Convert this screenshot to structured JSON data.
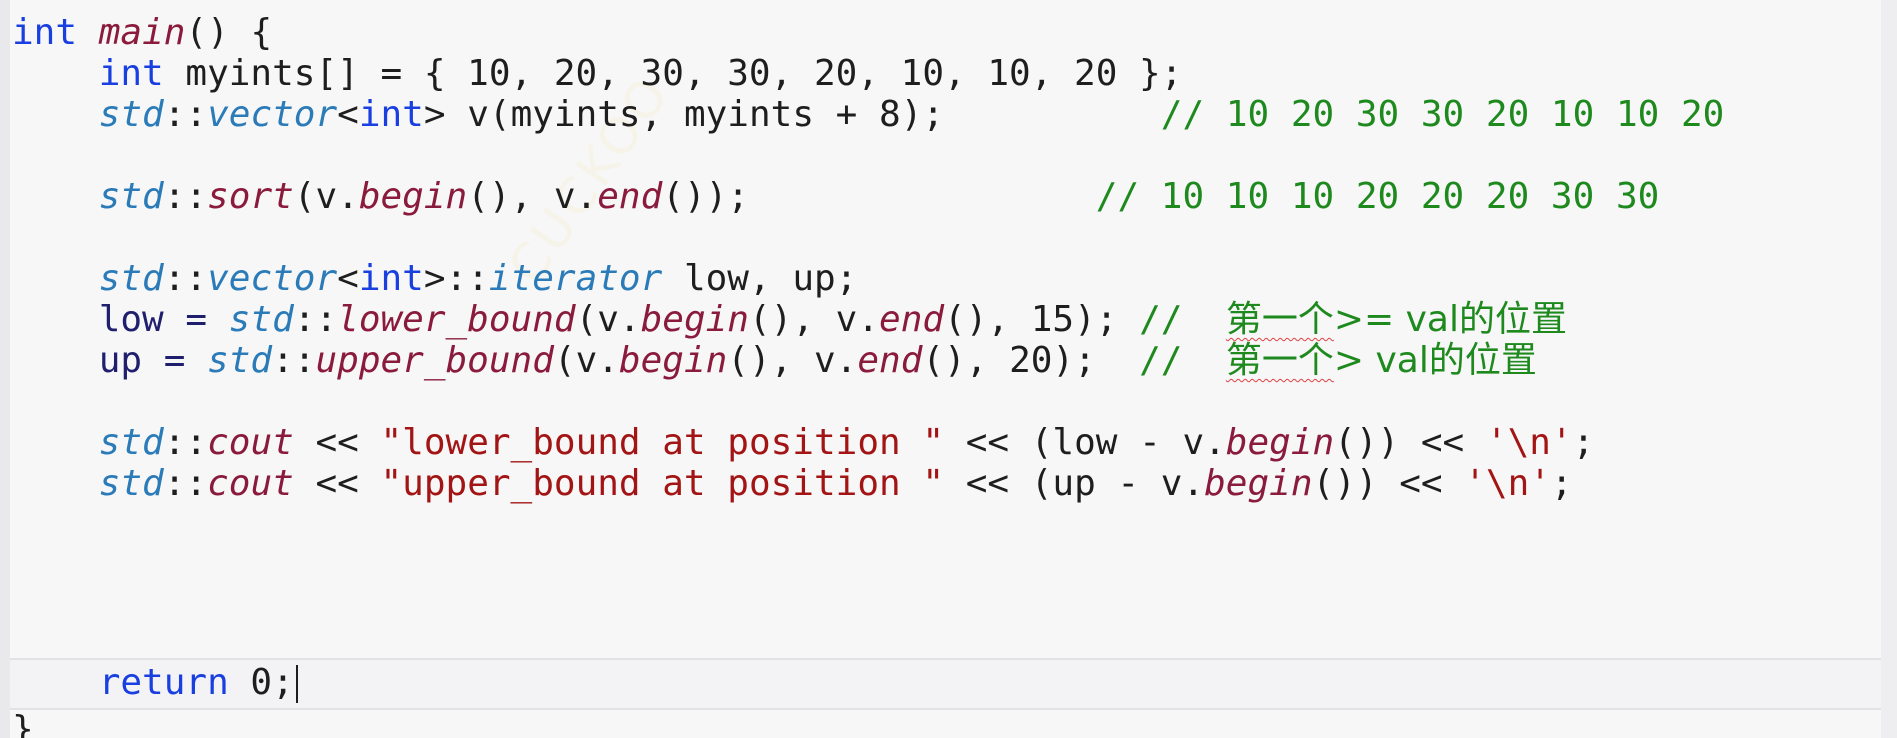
{
  "code": {
    "l1": {
      "kw_int": "int",
      "fn_main": "main",
      "rest": "() {"
    },
    "l2": {
      "indent": "    ",
      "kw_int": "int",
      "rest": " myints[] = { 10, 20, 30, 30, 20, 10, 10, 20 };"
    },
    "l3": {
      "indent": "    ",
      "ns": "std",
      "sep1": "::",
      "ty": "vector",
      "lt": "<",
      "kw_int": "int",
      "gt": "> ",
      "rest": "v(myints, myints + 8);",
      "pad": "          ",
      "comment": "// 10 20 30 30 20 10 10 20"
    },
    "l5": {
      "indent": "    ",
      "ns": "std",
      "sep1": "::",
      "fn": "sort",
      "p1": "(v.",
      "m1": "begin",
      "p2": "(), v.",
      "m2": "end",
      "p3": "());",
      "pad": "                ",
      "comment": "// 10 10 10 20 20 20 30 30"
    },
    "l7": {
      "indent": "    ",
      "ns": "std",
      "sep1": "::",
      "ty": "vector",
      "lt": "<",
      "kw_int": "int",
      "gt": ">::",
      "ty2": "iterator",
      "rest": " low, up;"
    },
    "l8": {
      "indent": "    ",
      "pre": "low = ",
      "ns": "std",
      "sep1": "::",
      "fn": "lower_bound",
      "p1": "(v.",
      "m1": "begin",
      "p2": "(), v.",
      "m2": "end",
      "p3": "(), 15); ",
      "cm_slash": "//  ",
      "cm_cn": "第一个",
      "cm_rest": ">= val的位置"
    },
    "l9": {
      "indent": "    ",
      "pre": "up = ",
      "ns": "std",
      "sep1": "::",
      "fn": "upper_bound",
      "p1": "(v.",
      "m1": "begin",
      "p2": "(), v.",
      "m2": "end",
      "p3": "(), 20);  ",
      "cm_slash": "//  ",
      "cm_cn": "第一个",
      "cm_rest": "> val的位置"
    },
    "l11": {
      "indent": "    ",
      "ns": "std",
      "sep1": "::",
      "obj": "cout",
      "op1": " << ",
      "str": "\"lower_bound at position \"",
      "op2": " << (low - v.",
      "m1": "begin",
      "p1": "()) << ",
      "chr": "'\\n'",
      "end": ";"
    },
    "l12": {
      "indent": "    ",
      "ns": "std",
      "sep1": "::",
      "obj": "cout",
      "op1": " << ",
      "str": "\"upper_bound at position \"",
      "op2": " << (up - v.",
      "m1": "begin",
      "p1": "()) << ",
      "chr": "'\\n'",
      "end": ";"
    },
    "l14": {
      "indent": "    ",
      "kw_return": "return",
      "rest": " 0;"
    },
    "l15": {
      "brace": "}"
    }
  },
  "watermark": "CUCKOO",
  "colors": {
    "keyword": "#1a3fe0",
    "namespace": "#2b7bb8",
    "function": "#8a1b3c",
    "string": "#a31515",
    "comment": "#1e8a1e",
    "background": "#f7f7f8"
  }
}
